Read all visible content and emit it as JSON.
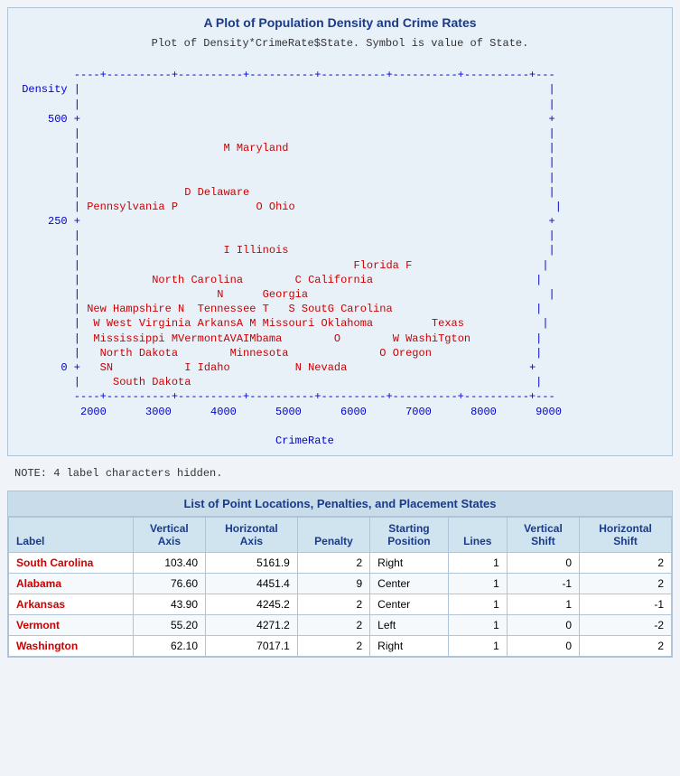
{
  "page": {
    "plot_title": "A Plot of Population Density and Crime Rates",
    "plot_subtitle": "Plot of Density*CrimeRate$State.  Symbol is value of State.",
    "note": "NOTE: 4 label characters hidden.",
    "table_title": "List of Point Locations, Penalties, and Placement States"
  },
  "table": {
    "headers": [
      "Label",
      "Vertical\nAxis",
      "Horizontal\nAxis",
      "Penalty",
      "Starting\nPosition",
      "Lines",
      "Vertical\nShift",
      "Horizontal\nShift"
    ],
    "rows": [
      {
        "label": "South Carolina",
        "vertical_axis": "103.40",
        "horizontal_axis": "5161.9",
        "penalty": "2",
        "starting_position": "Right",
        "lines": "1",
        "vertical_shift": "0",
        "horizontal_shift": "2"
      },
      {
        "label": "Alabama",
        "vertical_axis": "76.60",
        "horizontal_axis": "4451.4",
        "penalty": "9",
        "starting_position": "Center",
        "lines": "1",
        "vertical_shift": "-1",
        "horizontal_shift": "2"
      },
      {
        "label": "Arkansas",
        "vertical_axis": "43.90",
        "horizontal_axis": "4245.2",
        "penalty": "2",
        "starting_position": "Center",
        "lines": "1",
        "vertical_shift": "1",
        "horizontal_shift": "-1"
      },
      {
        "label": "Vermont",
        "vertical_axis": "55.20",
        "horizontal_axis": "4271.2",
        "penalty": "2",
        "starting_position": "Left",
        "lines": "1",
        "vertical_shift": "0",
        "horizontal_shift": "-2"
      },
      {
        "label": "Washington",
        "vertical_axis": "62.10",
        "horizontal_axis": "7017.1",
        "penalty": "2",
        "starting_position": "Right",
        "lines": "1",
        "vertical_shift": "0",
        "horizontal_shift": "2"
      }
    ]
  }
}
